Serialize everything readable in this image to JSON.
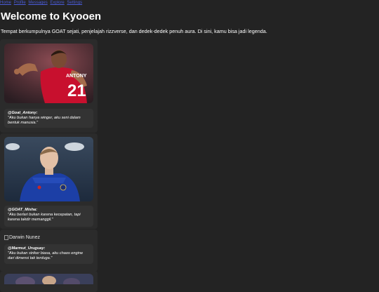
{
  "nav": {
    "links": [
      "Home",
      "Profile",
      "Messages",
      "Explore",
      "Settings"
    ]
  },
  "page": {
    "title": "Welcome to Kyooen",
    "intro": "Tempat berkumpulnya GOAT sejati, penjelajah rizzverse, dan dedek-dedek penuh aura. Di sini, kamu bisa jadi legenda."
  },
  "posts": [
    {
      "handle": "@Goat_Antony:",
      "quote": "\"Aku bukan hanya winger, aku seni dalam bentuk manusia.\"",
      "photo_text": "ANTONY 21"
    },
    {
      "handle": "@GOAT_Misha:",
      "quote": "\"Aku berlari bukan karena kecepatan, tapi karena takdir memanggil.\""
    },
    {
      "image_alt": "Darwin Nunez",
      "handle": "@Marmut_Uruguay:",
      "quote": "\"Aku bukan striker biasa, aku chaos engine dari dimensi tak terduga.\""
    }
  ],
  "colors": {
    "background": "#232323",
    "card": "#2b2b2b",
    "caption": "#333333",
    "link": "#4a5bd9"
  }
}
